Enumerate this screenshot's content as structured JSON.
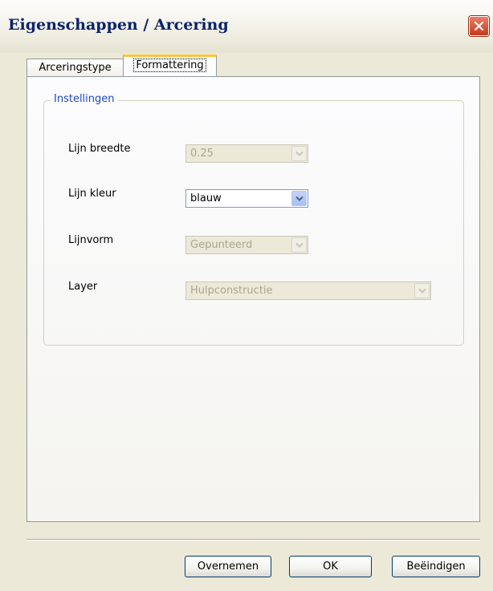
{
  "window": {
    "title": "Eigenschappen / Arcering"
  },
  "tabs": [
    {
      "label": "Arceringstype",
      "active": false
    },
    {
      "label": "Formattering",
      "active": true
    }
  ],
  "group": {
    "legend": "Instellingen"
  },
  "fields": {
    "line_width": {
      "label": "Lijn breedte",
      "value": "0.25",
      "enabled": false
    },
    "line_color": {
      "label": "Lijn kleur",
      "value": "blauw",
      "enabled": true
    },
    "line_style": {
      "label": "Lijnvorm",
      "value": "Gepunteerd",
      "enabled": false
    },
    "layer": {
      "label": "Layer",
      "value": "Hulpconstructie",
      "enabled": false
    }
  },
  "buttons": {
    "apply": "Overnemen",
    "ok": "OK",
    "close": "Beëindigen"
  },
  "icons": {
    "close": "close-x-icon",
    "dropdown": "chevron-down-icon"
  },
  "colors": {
    "title_text": "#0a246a",
    "legend_text": "#1f49c3",
    "close_button": "#c7391a",
    "active_tab_accent": "#ffc73c",
    "face": "#ece9d8"
  }
}
